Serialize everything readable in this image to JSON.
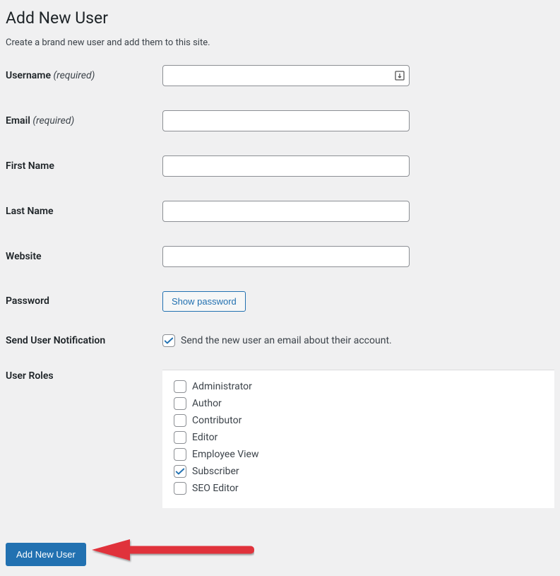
{
  "page": {
    "title": "Add New User",
    "description": "Create a brand new user and add them to this site."
  },
  "labels": {
    "username": "Username",
    "email": "Email",
    "first_name": "First Name",
    "last_name": "Last Name",
    "website": "Website",
    "password": "Password",
    "notification": "Send User Notification",
    "user_roles": "User Roles",
    "required": "(required)"
  },
  "fields": {
    "username_value": "",
    "email_value": "",
    "first_name_value": "",
    "last_name_value": "",
    "website_value": ""
  },
  "buttons": {
    "show_password": "Show password",
    "submit": "Add New User"
  },
  "notification": {
    "checked": true,
    "text": "Send the new user an email about their account."
  },
  "roles": [
    {
      "label": "Administrator",
      "checked": false
    },
    {
      "label": "Author",
      "checked": false
    },
    {
      "label": "Contributor",
      "checked": false
    },
    {
      "label": "Editor",
      "checked": false
    },
    {
      "label": "Employee View",
      "checked": false
    },
    {
      "label": "Subscriber",
      "checked": true
    },
    {
      "label": "SEO Editor",
      "checked": false
    }
  ],
  "colors": {
    "primary": "#2271b1",
    "arrow": "#e0303a"
  }
}
